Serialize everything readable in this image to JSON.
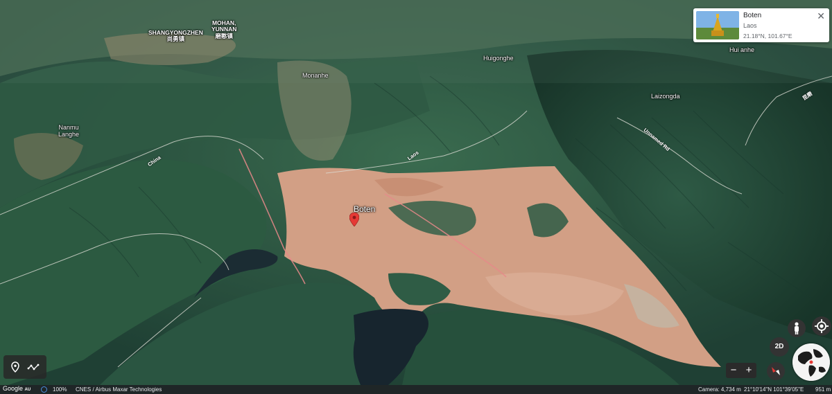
{
  "map": {
    "places": {
      "shangyongzhen": "SHANGYONGZHEN",
      "shangyongzhen_cn": "尚勇镇",
      "mohan": "MOHAN,",
      "yunnan": "YUNNAN",
      "mohan_cn": "磨憨镇",
      "monanhe": "Monanhe",
      "huigonghe": "Huigonghe",
      "huianhe": "Hui anhe",
      "laizongda": "Laizongda",
      "nanmu": "Nanmu",
      "langhe": "Langhe",
      "boten": "Boten"
    },
    "roads": {
      "china": "China",
      "laos": "Laos",
      "unnamed_road": "Unnamed Rd",
      "expressway": "昆磨"
    },
    "marker_icon": "red-location-pin-icon"
  },
  "info_card": {
    "title": "Boten",
    "subtitle": "Laos",
    "coordinates": "21.18°N, 101.67°E",
    "close_icon": "close-icon"
  },
  "controls": {
    "toggle_2d": "2D",
    "zoom_out": "−",
    "zoom_in": "+",
    "icons": [
      "location-pin-icon",
      "path-measure-icon",
      "pegman-icon",
      "my-location-icon",
      "compass-icon",
      "globe-icon"
    ]
  },
  "status_bar": {
    "logo": "Google",
    "logo_suffix": "AU",
    "zoom_percent": "100%",
    "attribution": "CNES / Airbus   Maxar Technologies",
    "camera": "Camera: 4,734 m",
    "latlng": "21°10'14\"N 101°39'05\"E",
    "elevation": "951 m"
  },
  "colors": {
    "terrain_dark": "#24473a",
    "terrain_light": "#3f6a4e",
    "cleared_land": "#d4a088",
    "water": "#17252e",
    "marker": "#e53935",
    "border_line": "#e8888a"
  }
}
